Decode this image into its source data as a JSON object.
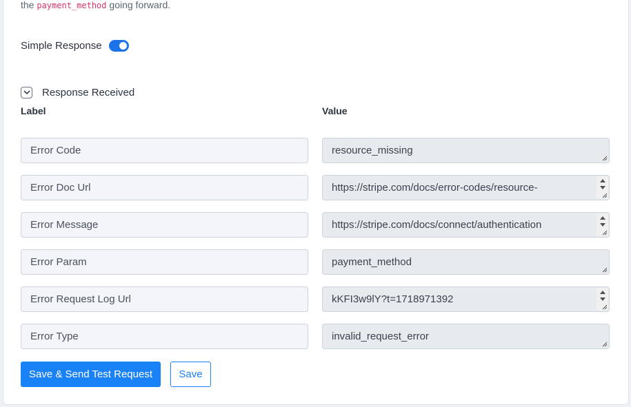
{
  "intro": {
    "prefix": "the",
    "code": "payment_method",
    "suffix": "going forward."
  },
  "simple_response": {
    "label": "Simple Response",
    "enabled": true
  },
  "response_received": {
    "label": "Response Received",
    "expanded": true
  },
  "table": {
    "label_header": "Label",
    "value_header": "Value",
    "rows": [
      {
        "label": "Error Code",
        "value": "resource_missing",
        "ghost": ""
      },
      {
        "label": "Error Doc Url",
        "value": "https://stripe.com/docs/error-codes/resource-",
        "ghost": ""
      },
      {
        "label": "Error Message",
        "value": "https://stripe.com/docs/connect/authentication",
        "ghost": ""
      },
      {
        "label": "Error Param",
        "value": "payment_method",
        "ghost": ""
      },
      {
        "label": "Error Request Log Url",
        "value": "kKFI3w9lY?t=1718971392",
        "ghost": ""
      },
      {
        "label": "Error Type",
        "value": "invalid_request_error",
        "ghost": ""
      }
    ]
  },
  "actions": {
    "save_send": "Save & Send Test Request",
    "save": "Save"
  },
  "colors": {
    "accent": "#1a82f7",
    "toggle": "#1a73e8"
  }
}
